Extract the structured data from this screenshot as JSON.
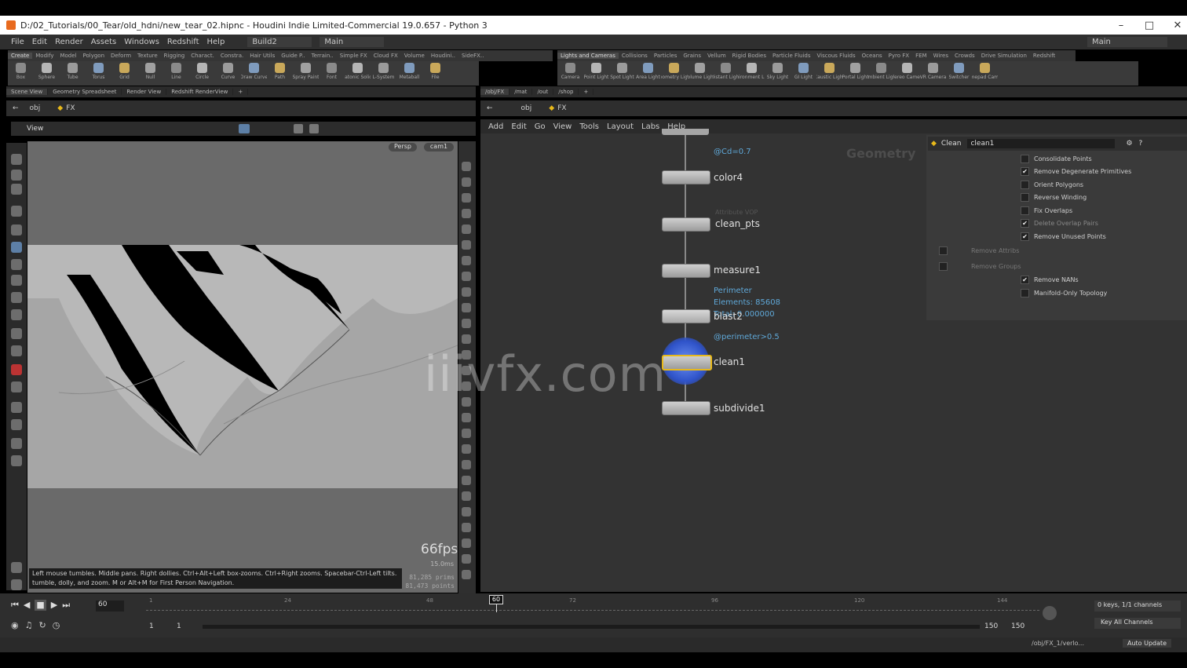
{
  "window": {
    "title": "D:/02_Tutorials/00_Tear/old_hdni/new_tear_02.hipnc - Houdini Indie Limited-Commercial 19.0.657 - Python 3"
  },
  "menu": [
    "File",
    "Edit",
    "Render",
    "Assets",
    "Windows",
    "Redshift",
    "Help"
  ],
  "desktop": {
    "name": "Build2",
    "main": "Main",
    "right_main": "Main"
  },
  "shelf_left_tabs": [
    "Create",
    "Modify",
    "Model",
    "Polygon",
    "Deform",
    "Texture",
    "Rigging",
    "Charact.",
    "Constra.",
    "Hair Utils",
    "Guide P..",
    "Terrain..",
    "Simple FX",
    "Cloud FX",
    "Volume",
    "Houdini..",
    "SideFX.."
  ],
  "shelf_left_tools": [
    "Box",
    "Sphere",
    "Tube",
    "Torus",
    "Grid",
    "Null",
    "Line",
    "Circle",
    "Curve",
    "Draw Curve",
    "Path",
    "Spray Paint",
    "Font",
    "Platonic Solids",
    "L-System",
    "Metaball",
    "File"
  ],
  "shelf_right_tabs": [
    "Lights and Cameras",
    "Collisions",
    "Particles",
    "Grains",
    "Vellum",
    "Rigid Bodies",
    "Particle Fluids",
    "Viscous Fluids",
    "Oceans",
    "Pyro FX",
    "FEM",
    "Wires",
    "Crowds",
    "Drive Simulation",
    "Redshift"
  ],
  "shelf_right_tools": [
    "Camera",
    "Point Light",
    "Spot Light",
    "Area Light",
    "Geometry Light",
    "Volume Light",
    "Distant Light",
    "Environment Light",
    "Sky Light",
    "GI Light",
    "Caustic Light",
    "Portal Light",
    "Ambient Light",
    "Stereo Camera",
    "VR Camera",
    "Switcher",
    "Gamepad Camera"
  ],
  "left_pane_tabs": [
    "Scene View",
    "Geometry Spreadsheet",
    "Render View",
    "Redshift RenderView"
  ],
  "right_pane_tabs": [
    "/obj/FX",
    "/mat",
    "/out",
    "/shop"
  ],
  "path": {
    "obj": "obj",
    "fx": "FX"
  },
  "viewport": {
    "label": "View",
    "persp": "Persp",
    "cam": "cam1",
    "hint_line1": "Left mouse tumbles. Middle pans. Right dollies. Ctrl+Alt+Left box-zooms. Ctrl+Right zooms. Spacebar-Ctrl-Left tilts. Hold L for alternate",
    "hint_line2": "tumble, dolly, and zoom.   M or Alt+M for First Person Navigation.",
    "fps": "66fps",
    "ms": "15.0ms",
    "prims": "81,285  prims",
    "points": "81,473  points"
  },
  "net_menu": [
    "Add",
    "Edit",
    "Go",
    "View",
    "Tools",
    "Layout",
    "Labs",
    "Help"
  ],
  "net_title": "Geometry",
  "nodes": [
    {
      "name": "color4",
      "sub": "@Cd=0.7"
    },
    {
      "name": "clean_pts",
      "sub": "Attribute VOP"
    },
    {
      "name": "measure1",
      "sub": "Perimeter"
    },
    {
      "name": "blast2",
      "sub": "@perimeter>0.5"
    },
    {
      "name": "clean1",
      "sub": ""
    },
    {
      "name": "subdivide1",
      "sub": ""
    }
  ],
  "measure_info": {
    "elements": "Elements: 85608",
    "range": "Total: 0.000000"
  },
  "params": {
    "type": "Clean",
    "name": "clean1",
    "options": [
      {
        "label": "Consolidate Points",
        "checked": false
      },
      {
        "label": "Remove Degenerate Primitives",
        "checked": true
      },
      {
        "label": "Orient Polygons",
        "checked": false
      },
      {
        "label": "Reverse Winding",
        "checked": false
      },
      {
        "label": "Fix Overlaps",
        "checked": false
      },
      {
        "label": "Delete Overlap Pairs",
        "checked": true
      },
      {
        "label": "Remove Unused Points",
        "checked": true
      },
      {
        "label": "Remove Attribs",
        "checked": false
      },
      {
        "label": "Remove Groups",
        "checked": false
      },
      {
        "label": "Remove NANs",
        "checked": true
      },
      {
        "label": "Manifold-Only Topology",
        "checked": false
      }
    ]
  },
  "timeline": {
    "frame": "60",
    "current": "60",
    "ticks": [
      "1",
      "24",
      "48",
      "72",
      "96",
      "120",
      "144"
    ],
    "start": "1",
    "start2": "1",
    "end": "150",
    "end2": "150",
    "keys": "0 keys, 1/1 channels",
    "key_all": "Key All Channels",
    "status_path": "/obj/FX_1/verlo...",
    "auto_update": "Auto Update"
  },
  "watermark": "iiivfx.com",
  "colors": {
    "accent": "#e8b91a",
    "selected_node": "#3a6fd0",
    "param_blue": "#5fa8d8"
  }
}
